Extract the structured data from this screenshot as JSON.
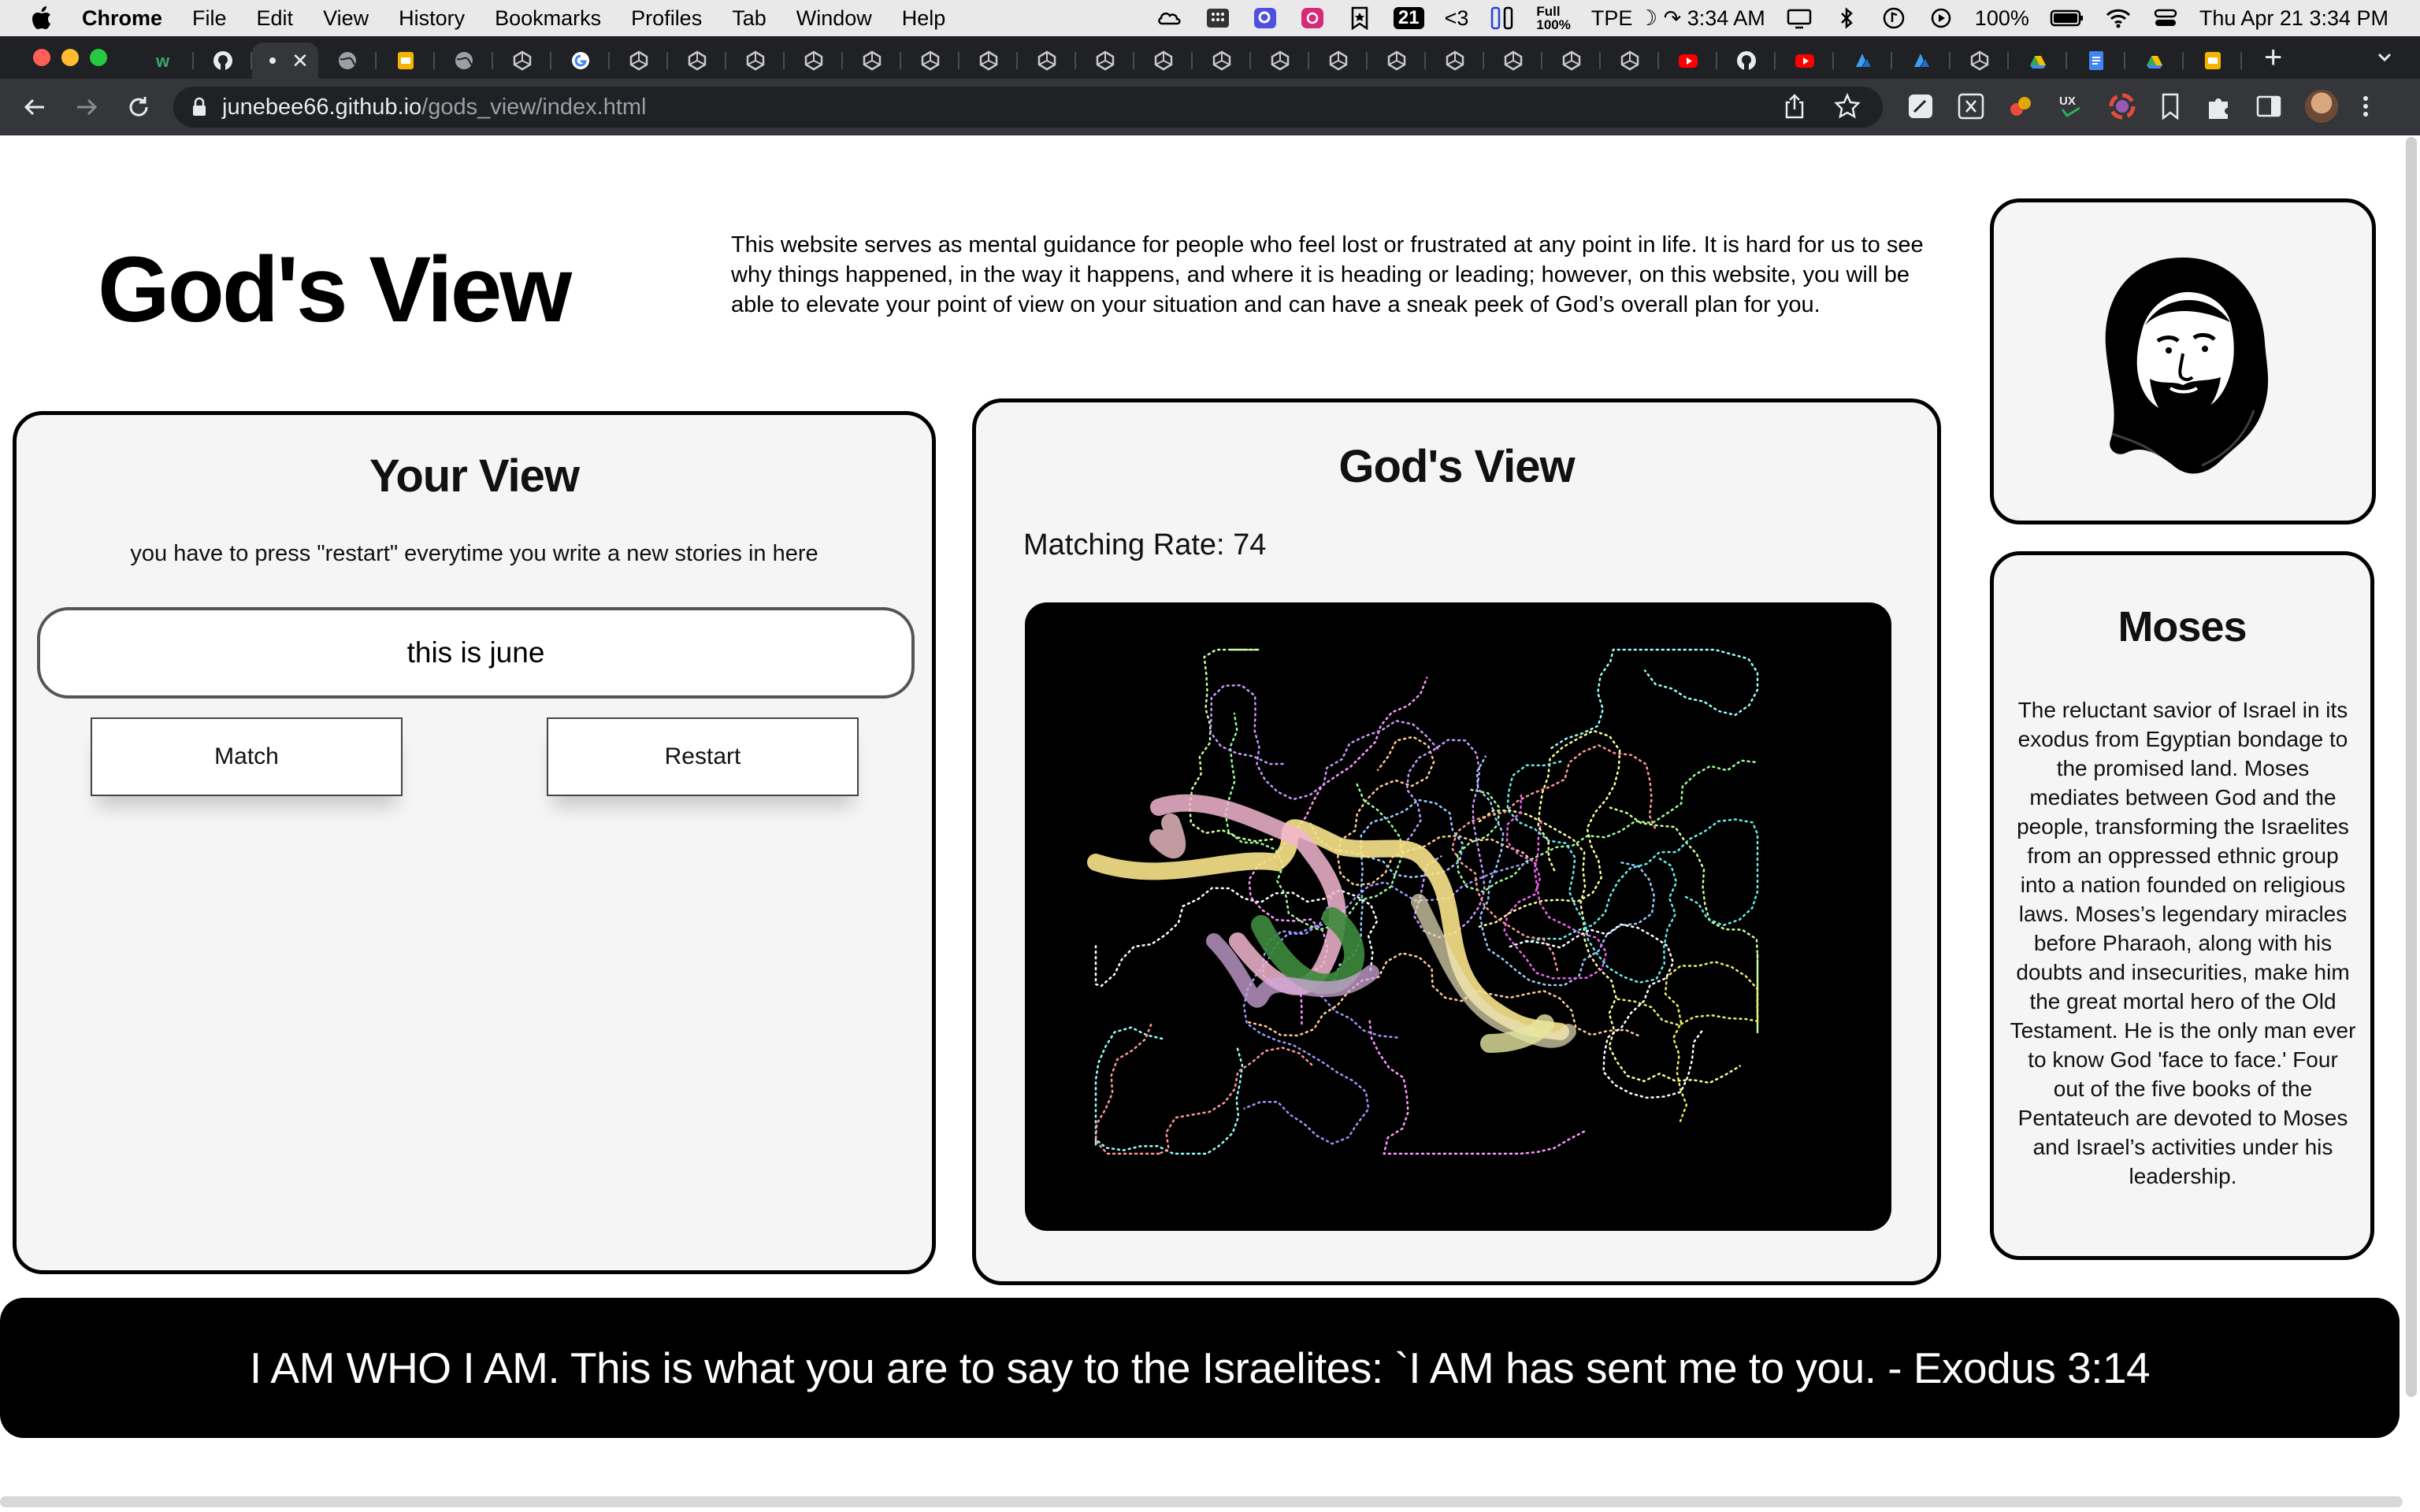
{
  "menubar": {
    "app": "Chrome",
    "items": [
      "File",
      "Edit",
      "View",
      "History",
      "Bookmarks",
      "Profiles",
      "Tab",
      "Window",
      "Help"
    ],
    "badge_count": "21",
    "heart_text": "<3",
    "full_label": "Full",
    "full_pct": "100%",
    "tpe_clock": "TPE",
    "tpe_time": "3:34 AM",
    "battery": "100%",
    "datetime": "Thu Apr 21  3:34 PM"
  },
  "browser": {
    "url_host": "junebee66.github.io",
    "url_path": "/gods_view/index.html",
    "tabs": [
      {
        "icon": "w-icon"
      },
      {
        "icon": "github-icon"
      },
      {
        "icon": "active-tab",
        "active": true
      },
      {
        "icon": "globe-icon"
      },
      {
        "icon": "slides-icon"
      },
      {
        "icon": "globe-icon"
      },
      {
        "icon": "unity-icon"
      },
      {
        "icon": "google-icon"
      },
      {
        "icon": "unity-icon"
      },
      {
        "icon": "unity-icon"
      },
      {
        "icon": "unity-icon"
      },
      {
        "icon": "unity-icon"
      },
      {
        "icon": "unity-icon"
      },
      {
        "icon": "unity-icon"
      },
      {
        "icon": "unity-icon"
      },
      {
        "icon": "unity-icon"
      },
      {
        "icon": "unity-icon"
      },
      {
        "icon": "unity-icon"
      },
      {
        "icon": "unity-icon"
      },
      {
        "icon": "unity-icon"
      },
      {
        "icon": "unity-icon"
      },
      {
        "icon": "unity-icon"
      },
      {
        "icon": "unity-icon"
      },
      {
        "icon": "unity-icon"
      },
      {
        "icon": "unity-icon"
      },
      {
        "icon": "unity-icon"
      },
      {
        "icon": "youtube-icon"
      },
      {
        "icon": "github-icon"
      },
      {
        "icon": "youtube-icon"
      },
      {
        "icon": "azure-icon"
      },
      {
        "icon": "azure-icon"
      },
      {
        "icon": "unity-icon"
      },
      {
        "icon": "drive-icon"
      },
      {
        "icon": "docs-icon"
      },
      {
        "icon": "drive-icon"
      },
      {
        "icon": "slides-icon"
      }
    ]
  },
  "header": {
    "title": "God's View",
    "description": "This website serves as mental guidance for people who feel lost or frustrated at any point in life. It is hard for us to see why things happened, in the way it happens, and where it is heading or leading; however, on this website, you will be able to elevate your point of view on your situation and can have a sneak peek of God’s overall plan for you."
  },
  "your_view": {
    "title": "Your View",
    "hint": "you have to press \"restart\" everytime you write a new stories in here",
    "input_value": "this is june",
    "match_label": "Match",
    "restart_label": "Restart"
  },
  "gods_view": {
    "title": "God's View",
    "rate_label": "Matching Rate:",
    "rate_value": "74"
  },
  "bio": {
    "name": "Moses",
    "text": "The reluctant savior of Israel in its exodus from Egyptian bondage to the promised land. Moses mediates between God and the people, transforming the Israelites from an oppressed ethnic group into a nation founded on religious laws. Moses’s legendary miracles before Pharaoh, along with his doubts and insecurities, make him the great mortal hero of the Old Testament. He is the only man ever to know God 'face to face.' Four out of the five books of the Pentateuch are devoted to Moses and Israel’s activities under his leadership."
  },
  "quote": {
    "text": "I AM WHO I AM. This is what you are to say to the Israelites: `I AM has sent me to you. - Exodus 3:14"
  },
  "colors": {
    "panel_bg": "#f5f5f5",
    "chrome_dark": "#202124",
    "chrome_toolbar": "#35363a"
  }
}
